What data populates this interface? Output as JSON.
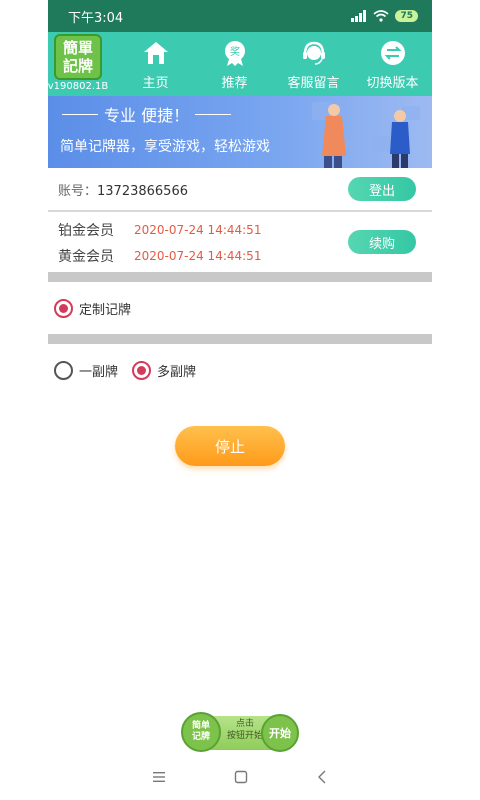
{
  "status": {
    "time": "下午3:04",
    "battery": "75"
  },
  "logo": {
    "line1": "簡單",
    "line2": "記牌",
    "version": "v190802.1B"
  },
  "nav": [
    {
      "label": "主页",
      "icon": "home-icon"
    },
    {
      "label": "推荐",
      "icon": "award-icon"
    },
    {
      "label": "客服留言",
      "icon": "headset-icon"
    },
    {
      "label": "切换版本",
      "icon": "switch-icon"
    }
  ],
  "banner": {
    "title": "专业 便捷！",
    "subtitle": "简单记牌器，享受游戏，轻松游戏"
  },
  "account": {
    "label": "账号：",
    "value": "13723866566",
    "logout_label": "登出"
  },
  "members": [
    {
      "name": "铂金会员",
      "date": "2020-07-24 14:44:51"
    },
    {
      "name": "黄金会员",
      "date": "2020-07-24 14:44:51"
    }
  ],
  "renew_label": "续购",
  "custom_option": {
    "label": "定制记牌",
    "checked": true
  },
  "deck_options": [
    {
      "label": "一副牌",
      "checked": false
    },
    {
      "label": "多副牌",
      "checked": true
    }
  ],
  "stop_label": "停止",
  "float_widget": {
    "logo_line1": "简单",
    "logo_line2": "记牌",
    "hint_line1": "点击",
    "hint_line2": "按钮开始",
    "start_label": "开始"
  },
  "colors": {
    "accent": "#3ccab1",
    "status_bar": "#1f7a5c",
    "date_red": "#e55a45",
    "radio_checked": "#d23c5a",
    "stop_orange": "#ff9a1a"
  }
}
